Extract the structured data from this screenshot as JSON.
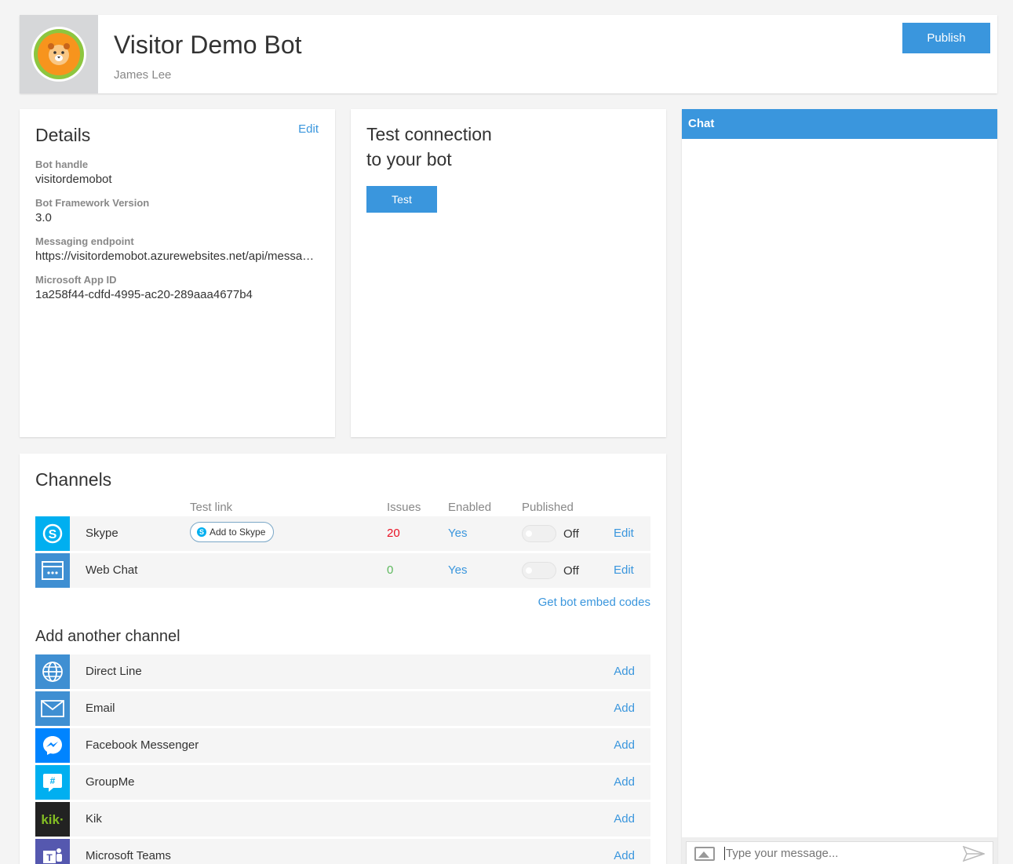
{
  "header": {
    "title": "Visitor Demo Bot",
    "owner": "James Lee",
    "publish_label": "Publish"
  },
  "details": {
    "title": "Details",
    "edit_label": "Edit",
    "fields": [
      {
        "label": "Bot handle",
        "value": "visitordemobot"
      },
      {
        "label": "Bot Framework Version",
        "value": "3.0"
      },
      {
        "label": "Messaging endpoint",
        "value": "https://visitordemobot.azurewebsites.net/api/messages"
      },
      {
        "label": "Microsoft App ID",
        "value": "1a258f44-cdfd-4995-ac20-289aaa4677b4"
      }
    ]
  },
  "test_connection": {
    "title_line1": "Test connection",
    "title_line2": "to your bot",
    "test_label": "Test"
  },
  "chat": {
    "title": "Chat",
    "input_placeholder": "Type your message..."
  },
  "channels": {
    "title": "Channels",
    "columns": {
      "test_link": "Test link",
      "issues": "Issues",
      "enabled": "Enabled",
      "published": "Published"
    },
    "rows": [
      {
        "name": "Skype",
        "test_link": "Add to Skype",
        "issues": "20",
        "issues_color": "#e81123",
        "enabled": "Yes",
        "published": "Off",
        "edit": "Edit"
      },
      {
        "name": "Web Chat",
        "issues": "0",
        "issues_color": "#5cb85c",
        "enabled": "Yes",
        "published": "Off",
        "edit": "Edit"
      }
    ],
    "embed_link": "Get bot embed codes",
    "add_title": "Add another channel",
    "add_rows": [
      {
        "name": "Direct Line",
        "add": "Add",
        "icon": "globe-icon",
        "color": "#3a96dd"
      },
      {
        "name": "Email",
        "add": "Add",
        "icon": "envelope-icon",
        "color": "#3a96dd"
      },
      {
        "name": "Facebook Messenger",
        "add": "Add",
        "icon": "messenger-icon",
        "color": "#0084ff"
      },
      {
        "name": "GroupMe",
        "add": "Add",
        "icon": "groupme-icon",
        "color": "#00aff0"
      },
      {
        "name": "Kik",
        "add": "Add",
        "icon": "kik-icon",
        "color": "#222222"
      },
      {
        "name": "Microsoft Teams",
        "add": "Add",
        "icon": "teams-icon",
        "color": "#5558af"
      }
    ]
  },
  "colors": {
    "accent": "#3a96dd",
    "skype": "#00aff0"
  }
}
